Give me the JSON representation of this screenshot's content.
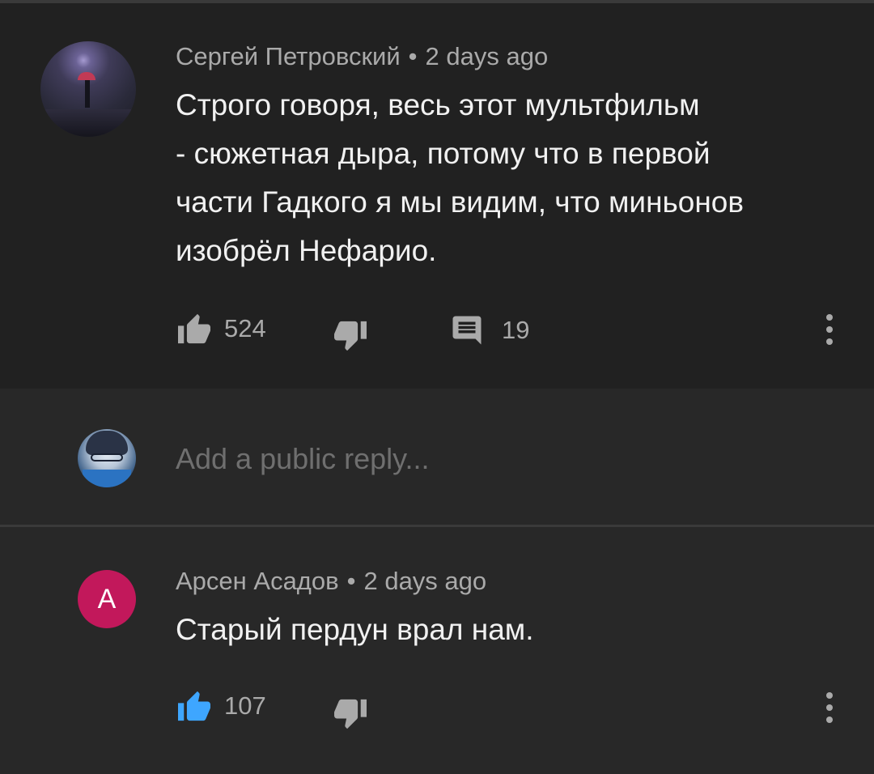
{
  "comment": {
    "author": "Сергей Петровский",
    "separator": "•",
    "time": "2 days ago",
    "lines": [
      "Строго говоря, весь этот мультфильм",
      "- сюжетная дыра, потому что в первой",
      "части Гадкого я мы видим, что миньонов",
      "изобрёл Нефарио."
    ],
    "likes": "524",
    "replies": "19",
    "avatar_icon": "user-avatar-umbrella"
  },
  "reply_box": {
    "placeholder": "Add a public reply..."
  },
  "reply": {
    "avatar_letter": "A",
    "avatar_color": "#c2185b",
    "author": "Арсен Асадов",
    "separator": "•",
    "time": "2 days ago",
    "text": "Старый пердун врал нам.",
    "likes": "107",
    "like_active_color": "#3ea6ff"
  },
  "colors": {
    "background": "#282828",
    "card": "#212121",
    "muted_text": "#aaaaaa",
    "primary_text": "#f1f1f1"
  }
}
